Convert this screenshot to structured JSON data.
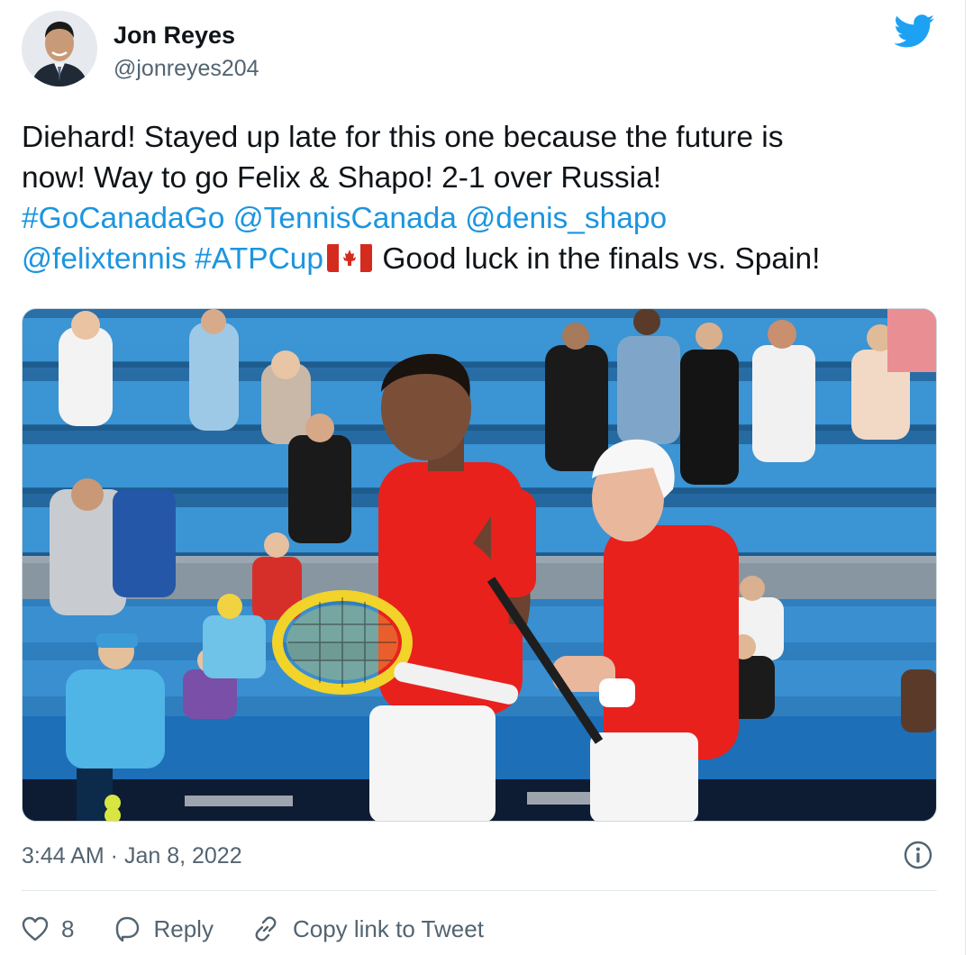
{
  "author": {
    "name": "Jon Reyes",
    "handle": "@jonreyes204",
    "avatar_icon": "profile-photo"
  },
  "tweet": {
    "lines": [
      [
        {
          "text": "Diehard! Stayed up late for this one because the future is",
          "link": false
        }
      ],
      [
        {
          "text": "now! Way to go Felix & Shapo! 2-1 over Russia!",
          "link": false
        }
      ],
      [
        {
          "text": "#GoCanadaGo",
          "link": true
        },
        {
          "text": " ",
          "link": false
        },
        {
          "text": "@TennisCanada",
          "link": true
        },
        {
          "text": " ",
          "link": false
        },
        {
          "text": "@denis_shapo",
          "link": true
        }
      ],
      [
        {
          "text": "@felixtennis",
          "link": true
        },
        {
          "text": " ",
          "link": false
        },
        {
          "text": "#ATPCup",
          "link": true
        },
        {
          "text": "FLAG",
          "link": false
        },
        {
          "text": " Good luck in the finals vs. Spain!",
          "link": false
        }
      ]
    ],
    "flag_icon": "canada-flag-emoji"
  },
  "media": {
    "icon": "tennis-match-photo"
  },
  "meta": {
    "timestamp": "3:44 AM · Jan 8, 2022"
  },
  "actions": {
    "like_count": "8",
    "reply_label": "Reply",
    "copy_link_label": "Copy link to Tweet"
  },
  "colors": {
    "link": "#1b95e0",
    "twitter_blue": "#1da1f2",
    "text": "#0f1419",
    "secondary": "#536471"
  }
}
